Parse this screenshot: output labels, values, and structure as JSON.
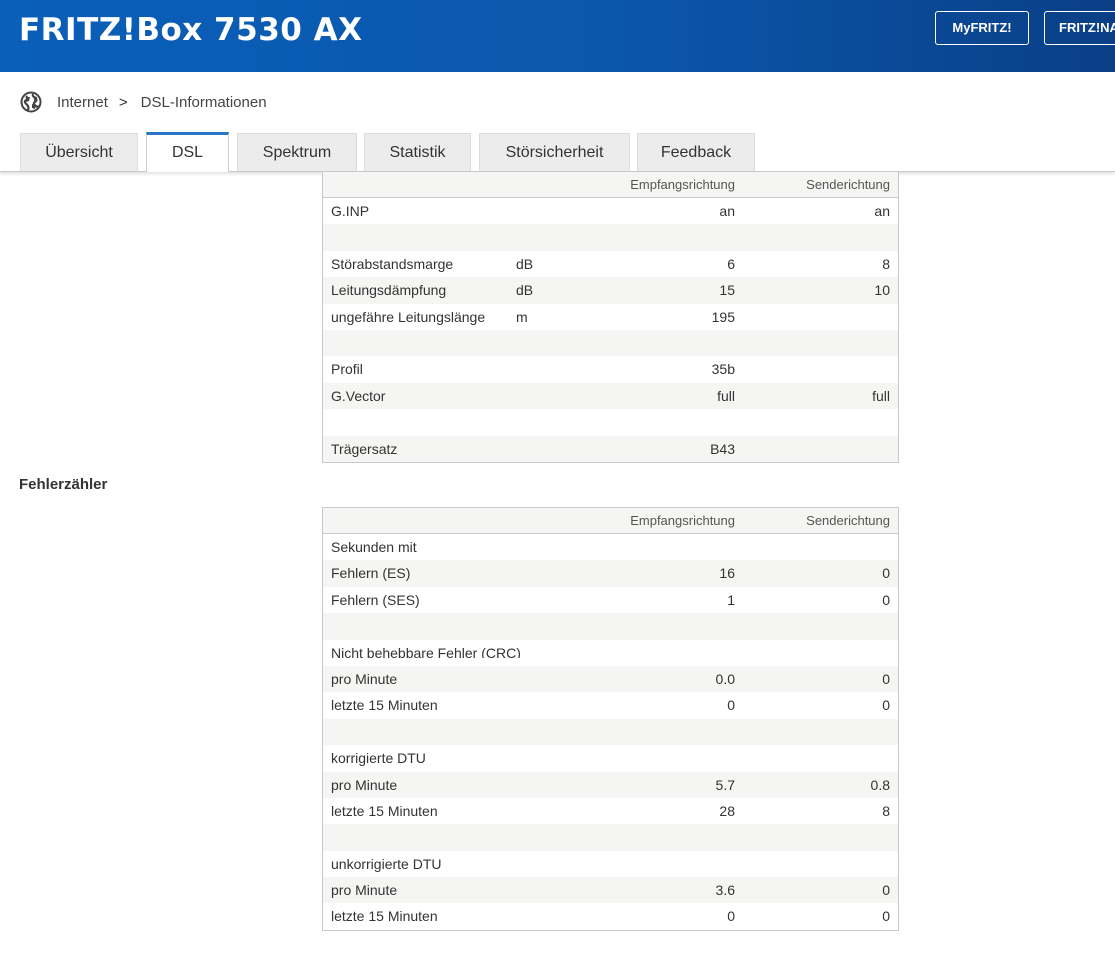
{
  "header": {
    "title": "FRITZ!Box 7530 AX",
    "myfritz_label": "MyFRITZ!",
    "fritzna_label": "FRITZ!NAS",
    "background_color": "#0b57ad"
  },
  "breadcrumb": {
    "icon": "globe-icon",
    "items": [
      "Internet",
      "DSL-Informationen"
    ],
    "separator": ">"
  },
  "tabs": [
    {
      "label": "Übersicht",
      "active": false
    },
    {
      "label": "DSL",
      "active": true
    },
    {
      "label": "Spektrum",
      "active": false
    },
    {
      "label": "Statistik",
      "active": false
    },
    {
      "label": "Störsicherheit",
      "active": false
    },
    {
      "label": "Feedback",
      "active": false
    }
  ],
  "line_table": {
    "headers": {
      "rx": "Empfangsrichtung",
      "tx": "Senderichtung"
    },
    "rows": [
      {
        "label": "G.INP",
        "unit": "",
        "rx": "an",
        "tx": "an"
      },
      {
        "label": "",
        "unit": "",
        "rx": "",
        "tx": ""
      },
      {
        "label": "Störabstandsmarge",
        "unit": "dB",
        "rx": "6",
        "tx": "8"
      },
      {
        "label": "Leitungsdämpfung",
        "unit": "dB",
        "rx": "15",
        "tx": "10"
      },
      {
        "label": "ungefähre Leitungslänge",
        "unit": "m",
        "rx": "195",
        "tx": ""
      },
      {
        "label": "",
        "unit": "",
        "rx": "",
        "tx": ""
      },
      {
        "label": "Profil",
        "unit": "",
        "rx": "35b",
        "tx": ""
      },
      {
        "label": "G.Vector",
        "unit": "",
        "rx": "full",
        "tx": "full"
      },
      {
        "label": "",
        "unit": "",
        "rx": "",
        "tx": ""
      },
      {
        "label": "Trägersatz",
        "unit": "",
        "rx": "B43",
        "tx": ""
      }
    ]
  },
  "errors_section": {
    "title": "Fehlerzähler"
  },
  "error_table": {
    "headers": {
      "rx": "Empfangsrichtung",
      "tx": "Senderichtung"
    },
    "rows": [
      {
        "label": "Sekunden mit",
        "rx": "",
        "tx": ""
      },
      {
        "label": "Fehlern (ES)",
        "rx": "16",
        "tx": "0"
      },
      {
        "label": "Fehlern (SES)",
        "rx": "1",
        "tx": "0"
      },
      {
        "label": "",
        "rx": "",
        "tx": ""
      },
      {
        "label": "Nicht behebbare Fehler (CRC)",
        "rx": "",
        "tx": "",
        "clipped": true
      },
      {
        "label": "pro Minute",
        "rx": "0.0",
        "tx": "0"
      },
      {
        "label": "letzte 15 Minuten",
        "rx": "0",
        "tx": "0"
      },
      {
        "label": "",
        "rx": "",
        "tx": ""
      },
      {
        "label": "korrigierte DTU",
        "rx": "",
        "tx": ""
      },
      {
        "label": "pro Minute",
        "rx": "5.7",
        "tx": "0.8"
      },
      {
        "label": "letzte 15 Minuten",
        "rx": "28",
        "tx": "8"
      },
      {
        "label": "",
        "rx": "",
        "tx": ""
      },
      {
        "label": "unkorrigierte DTU",
        "rx": "",
        "tx": ""
      },
      {
        "label": "pro Minute",
        "rx": "3.6",
        "tx": "0"
      },
      {
        "label": "letzte 15 Minuten",
        "rx": "0",
        "tx": "0"
      }
    ]
  }
}
